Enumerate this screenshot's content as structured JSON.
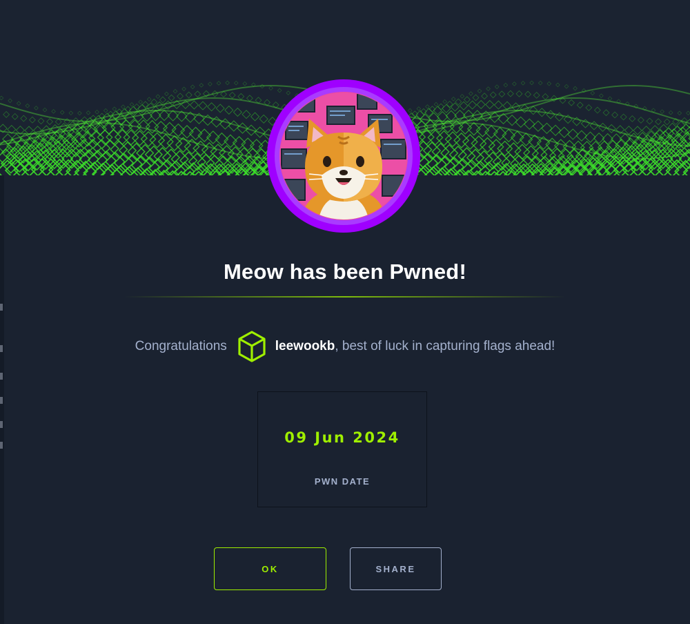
{
  "modal": {
    "title": "Meow has been Pwned!",
    "congrats_prefix": "Congratulations",
    "username": "leewookb",
    "congrats_suffix": ", best of luck in capturing flags ahead!",
    "pwn_date": "09 Jun 2024",
    "pwn_date_label": "PWN DATE",
    "ok_label": "OK",
    "share_label": "SHARE"
  },
  "icons": {
    "user_rank_icon": "cube-icon",
    "machine_avatar": "cat-avatar-icon"
  },
  "colors": {
    "accent": "#9fef00",
    "avatar_ring": "#9f00ff",
    "background": "#1a2230",
    "text_muted": "#a4b1cd"
  }
}
